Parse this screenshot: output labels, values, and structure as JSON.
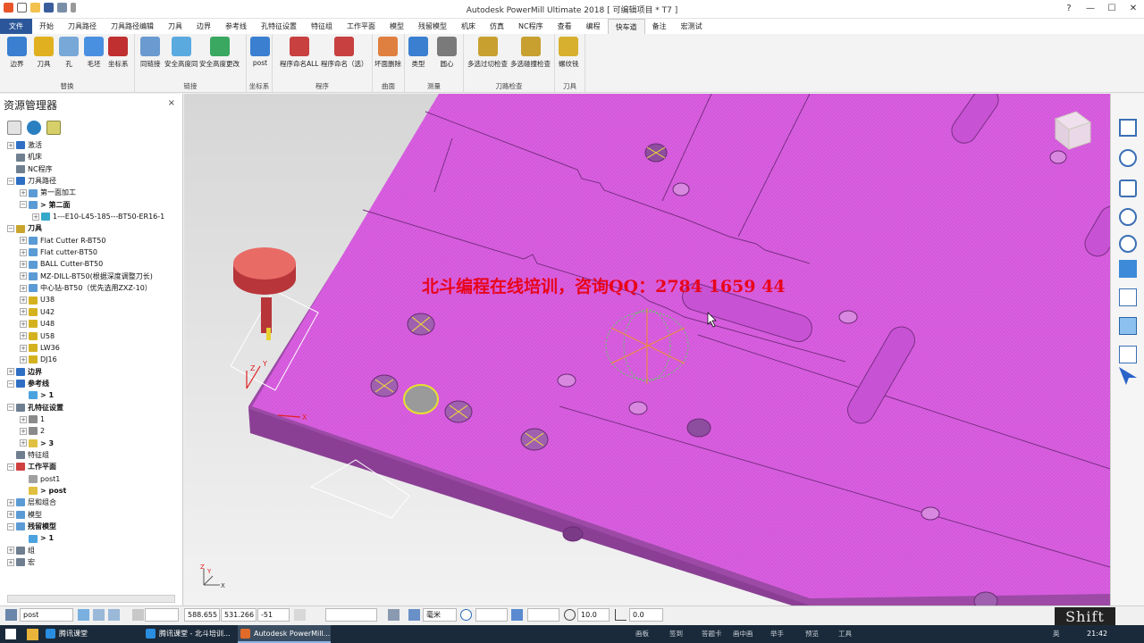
{
  "window": {
    "title": "Autodesk PowerMill Ultimate 2018  [ 可编辑项目 * T7 ]",
    "controls": {
      "help": "?",
      "minimize": "—",
      "maximize": "☐",
      "close": "✕"
    }
  },
  "menu": {
    "tabs": [
      "文件",
      "开始",
      "刀具路径",
      "刀具路径编辑",
      "刀具",
      "边界",
      "参考线",
      "孔特征设置",
      "特征组",
      "工作平面",
      "模型",
      "残留模型",
      "机床",
      "仿真",
      "NC程序",
      "查看",
      "编程",
      "快车道",
      "备注",
      "宏测试"
    ],
    "active_index": 17
  },
  "ribbon": {
    "groups": [
      {
        "label": "替换",
        "buttons": [
          "边界",
          "刀具",
          "孔",
          "毛坯",
          "坐标系"
        ]
      },
      {
        "label": "链接",
        "buttons": [
          "同链接",
          "安全高度同",
          "安全高度更改"
        ]
      },
      {
        "label": "坐标系",
        "buttons": [
          "post"
        ]
      },
      {
        "label": "程序",
        "buttons": [
          "程序命名ALL",
          "程序命名（选）"
        ]
      },
      {
        "label": "曲面",
        "buttons": [
          "坏面删除"
        ]
      },
      {
        "label": "测量",
        "buttons": [
          "类型",
          "圆心"
        ]
      },
      {
        "label": "刀路检查",
        "buttons": [
          "多选过切检查",
          "多选碰撞检查"
        ]
      },
      {
        "label": "刀具",
        "buttons": [
          "螺纹铣"
        ]
      }
    ]
  },
  "explorer": {
    "title": "资源管理器",
    "close": "×",
    "tree": [
      {
        "label": "激活",
        "indent": 0,
        "expander": "+",
        "color": "#2e6fc4"
      },
      {
        "label": "机床",
        "indent": 0,
        "expander": "",
        "color": "#6f7f8f"
      },
      {
        "label": "NC程序",
        "indent": 0,
        "expander": "",
        "color": "#6f7f8f"
      },
      {
        "label": "刀具路径",
        "indent": 0,
        "expander": "−",
        "color": "#2e6fc4"
      },
      {
        "label": "第一面加工",
        "indent": 1,
        "expander": "+",
        "color": "#5b9bd5"
      },
      {
        "label": "> 第二面",
        "indent": 1,
        "expander": "−",
        "color": "#5b9bd5",
        "bold": true
      },
      {
        "label": "1---E10-L45-185---BT50-ER16-1",
        "indent": 2,
        "expander": "+",
        "color": "#34a8c9"
      },
      {
        "label": "刀具",
        "indent": 0,
        "expander": "−",
        "color": "#c9a52e",
        "bold": true
      },
      {
        "label": "Flat Cutter R-BT50",
        "indent": 1,
        "expander": "+",
        "color": "#5b9bd5"
      },
      {
        "label": "Flat cutter-BT50",
        "indent": 1,
        "expander": "+",
        "color": "#5b9bd5"
      },
      {
        "label": "BALL Cutter-BT50",
        "indent": 1,
        "expander": "+",
        "color": "#5b9bd5"
      },
      {
        "label": "MZ-DILL-BT50(根据深度调整刀长)",
        "indent": 1,
        "expander": "+",
        "color": "#5b9bd5"
      },
      {
        "label": "中心钻-BT50（优先选用ZXZ-10）",
        "indent": 1,
        "expander": "+",
        "color": "#5b9bd5"
      },
      {
        "label": "U38",
        "indent": 1,
        "expander": "+",
        "color": "#d4b21f"
      },
      {
        "label": "U42",
        "indent": 1,
        "expander": "+",
        "color": "#d4b21f"
      },
      {
        "label": "U48",
        "indent": 1,
        "expander": "+",
        "color": "#d4b21f"
      },
      {
        "label": "U58",
        "indent": 1,
        "expander": "+",
        "color": "#d4b21f"
      },
      {
        "label": "LW36",
        "indent": 1,
        "expander": "+",
        "color": "#d4b21f"
      },
      {
        "label": "DJ16",
        "indent": 1,
        "expander": "+",
        "color": "#d4b21f"
      },
      {
        "label": "边界",
        "indent": 0,
        "expander": "+",
        "color": "#2e6fc4",
        "bold": true
      },
      {
        "label": "参考线",
        "indent": 0,
        "expander": "−",
        "color": "#2e6fc4",
        "bold": true
      },
      {
        "label": "> 1",
        "indent": 1,
        "expander": "",
        "color": "#4aa3df",
        "bold": true
      },
      {
        "label": "孔特征设置",
        "indent": 0,
        "expander": "−",
        "color": "#6f7f8f",
        "bold": true
      },
      {
        "label": "1",
        "indent": 1,
        "expander": "+",
        "color": "#8a8a8a"
      },
      {
        "label": "2",
        "indent": 1,
        "expander": "+",
        "color": "#8a8a8a"
      },
      {
        "label": "> 3",
        "indent": 1,
        "expander": "+",
        "color": "#e0c040",
        "bold": true
      },
      {
        "label": "特征组",
        "indent": 0,
        "expander": "",
        "color": "#6f7f8f"
      },
      {
        "label": "工作平面",
        "indent": 0,
        "expander": "−",
        "color": "#d04040",
        "bold": true
      },
      {
        "label": "post1",
        "indent": 1,
        "expander": "",
        "color": "#a0a0a0"
      },
      {
        "label": "> post",
        "indent": 1,
        "expander": "",
        "color": "#e0c040",
        "bold": true
      },
      {
        "label": "层和组合",
        "indent": 0,
        "expander": "+",
        "color": "#5b9bd5"
      },
      {
        "label": "模型",
        "indent": 0,
        "expander": "+",
        "color": "#5b9bd5"
      },
      {
        "label": "残留模型",
        "indent": 0,
        "expander": "−",
        "color": "#5b9bd5",
        "bold": true
      },
      {
        "label": "> 1",
        "indent": 1,
        "expander": "",
        "color": "#4aa3df",
        "bold": true
      },
      {
        "label": "组",
        "indent": 0,
        "expander": "+",
        "color": "#6f7f8f"
      },
      {
        "label": "宏",
        "indent": 0,
        "expander": "+",
        "color": "#6f7f8f"
      }
    ]
  },
  "viewport": {
    "watermark": "北斗编程在线培训，咨询QQ：2784 1659 44",
    "axis_labels": {
      "z": "Z",
      "y": "Y",
      "x": "X"
    },
    "colors": {
      "part": "#d95fe0",
      "part_side": "#9c4aa6",
      "cutter_head": "#e86b66",
      "cutter_shank": "#b8353a"
    }
  },
  "statusbar": {
    "workplane": "post",
    "x": "588.655",
    "y": "531.266",
    "z": "-51",
    "unit": "毫米",
    "tolerance": "10.0",
    "angle": "0.0"
  },
  "overlay": {
    "key": "Shift"
  },
  "taskbar": {
    "tasks": [
      {
        "label": "腾讯课堂",
        "icon_color": "#2a8ee0",
        "active": false
      },
      {
        "label": "腾讯课堂 - 北斗培训...",
        "icon_color": "#2a8ee0",
        "active": false
      },
      {
        "label": "Autodesk PowerMill...",
        "icon_color": "#e06a2a",
        "active": true
      }
    ],
    "tray_items": [
      "画板",
      "签到",
      "答题卡",
      "画中画",
      "举手",
      "预览",
      "工具"
    ],
    "ime": "英",
    "clock": "21:42"
  }
}
